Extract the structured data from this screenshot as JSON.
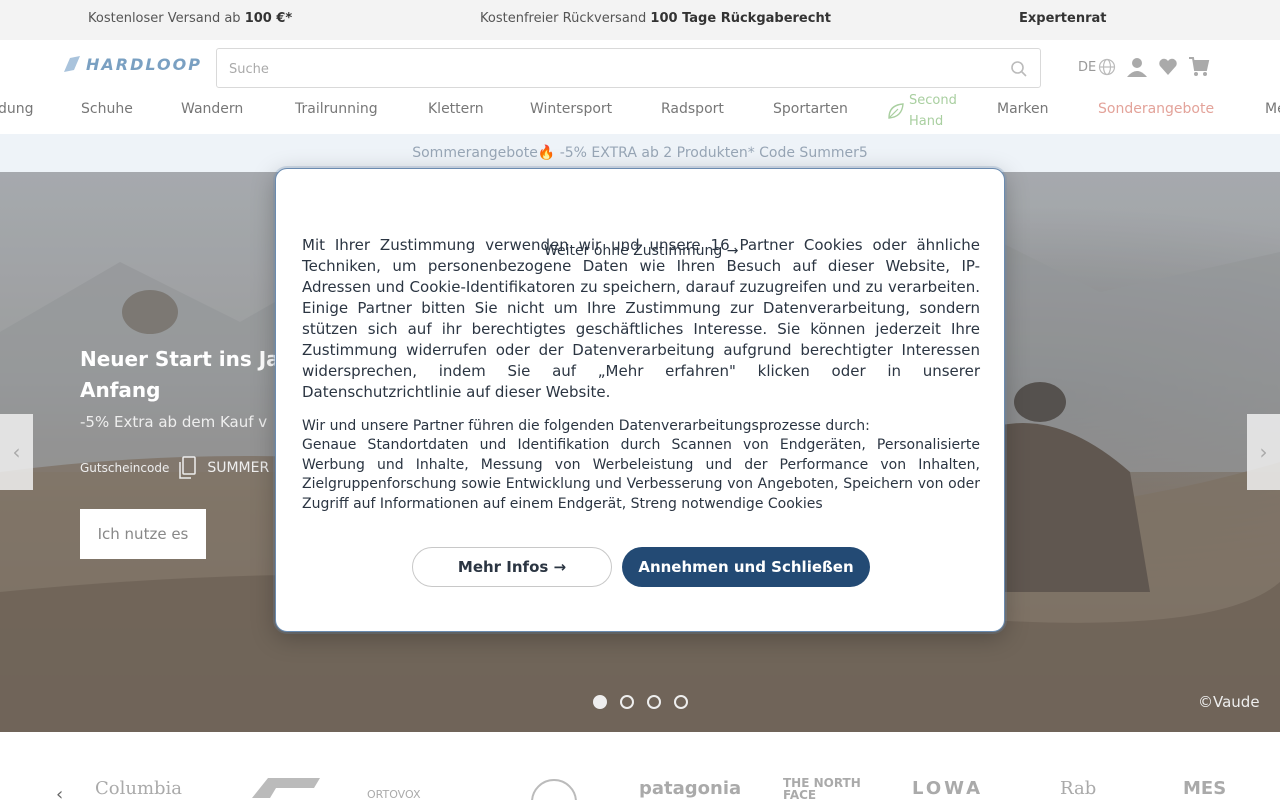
{
  "topbar": {
    "shipping_text": "Kostenloser Versand ab ",
    "shipping_bold": "100 €*",
    "returns_text": "Kostenfreier Rückversand ",
    "returns_bold": "100 Tage Rückgaberecht",
    "advice": "Expertenrat"
  },
  "header": {
    "logo_text": "HARDLOOP",
    "search_placeholder": "Suche",
    "language": "DE"
  },
  "nav": {
    "items": [
      "dung",
      "Schuhe",
      "Wandern",
      "Trailrunning",
      "Klettern",
      "Wintersport",
      "Radsport",
      "Sportarten",
      "Second Hand",
      "Marken",
      "Sonderangebote",
      "Me"
    ]
  },
  "promo": {
    "text": "Sommerangebote🔥 -5% EXTRA ab 2 Produkten* Code Summer5"
  },
  "hero": {
    "title_line1": "Neuer Start ins Jah",
    "title_line2": "Anfang",
    "subtitle": "-5% Extra ab dem Kauf v",
    "code_label": "Gutscheincode",
    "code_value": "SUMMER",
    "cta": "Ich nutze es",
    "credit": "©Vaude",
    "slides": 4,
    "active_slide": 1
  },
  "brands": {
    "names": [
      "Columbia",
      "ORTOVOX",
      "patagonia",
      "THE NORTH FACE",
      "LOWA",
      "Rab",
      "MES"
    ]
  },
  "modal": {
    "skip_link": "Weiter ohne Zustimmung →",
    "consent_text": "Mit Ihrer Zustimmung verwenden wir und unsere 16 Partner Cookies oder ähnliche Techniken, um personenbezogene Daten wie Ihren Besuch auf dieser Website, IP-Adressen und Cookie-Identifikatoren zu speichern, darauf zuzugreifen und zu verarbeiten. Einige Partner bitten Sie nicht um Ihre Zustimmung zur Datenverarbeitung, sondern stützen sich auf ihr berechtigtes geschäftliches Interesse. Sie können jederzeit Ihre Zustimmung widerrufen oder der Datenverarbeitung aufgrund berechtigter Interessen widersprechen, indem Sie auf „Mehr erfahren\" klicken oder in unserer Datenschutzrichtlinie auf dieser Website.",
    "purposes_title": "Wir und unsere Partner führen die folgenden Datenverarbeitungsprozesse durch:",
    "purposes_text": "Genaue Standortdaten und Identifikation durch Scannen von Endgeräten, Personalisierte Werbung und Inhalte, Messung von Werbeleistung und der Performance von Inhalten, Zielgruppenforschung sowie Entwicklung und Verbesserung von Angeboten, Speichern von oder Zugriff auf Informationen auf einem Endgerät, Streng notwendige Cookies",
    "more_button": "Mehr Infos →",
    "accept_button": "Annehmen und Schließen"
  },
  "colors": {
    "accent": "#234a74",
    "sale": "#e3a39a",
    "second_hand": "#a9cfa0"
  }
}
